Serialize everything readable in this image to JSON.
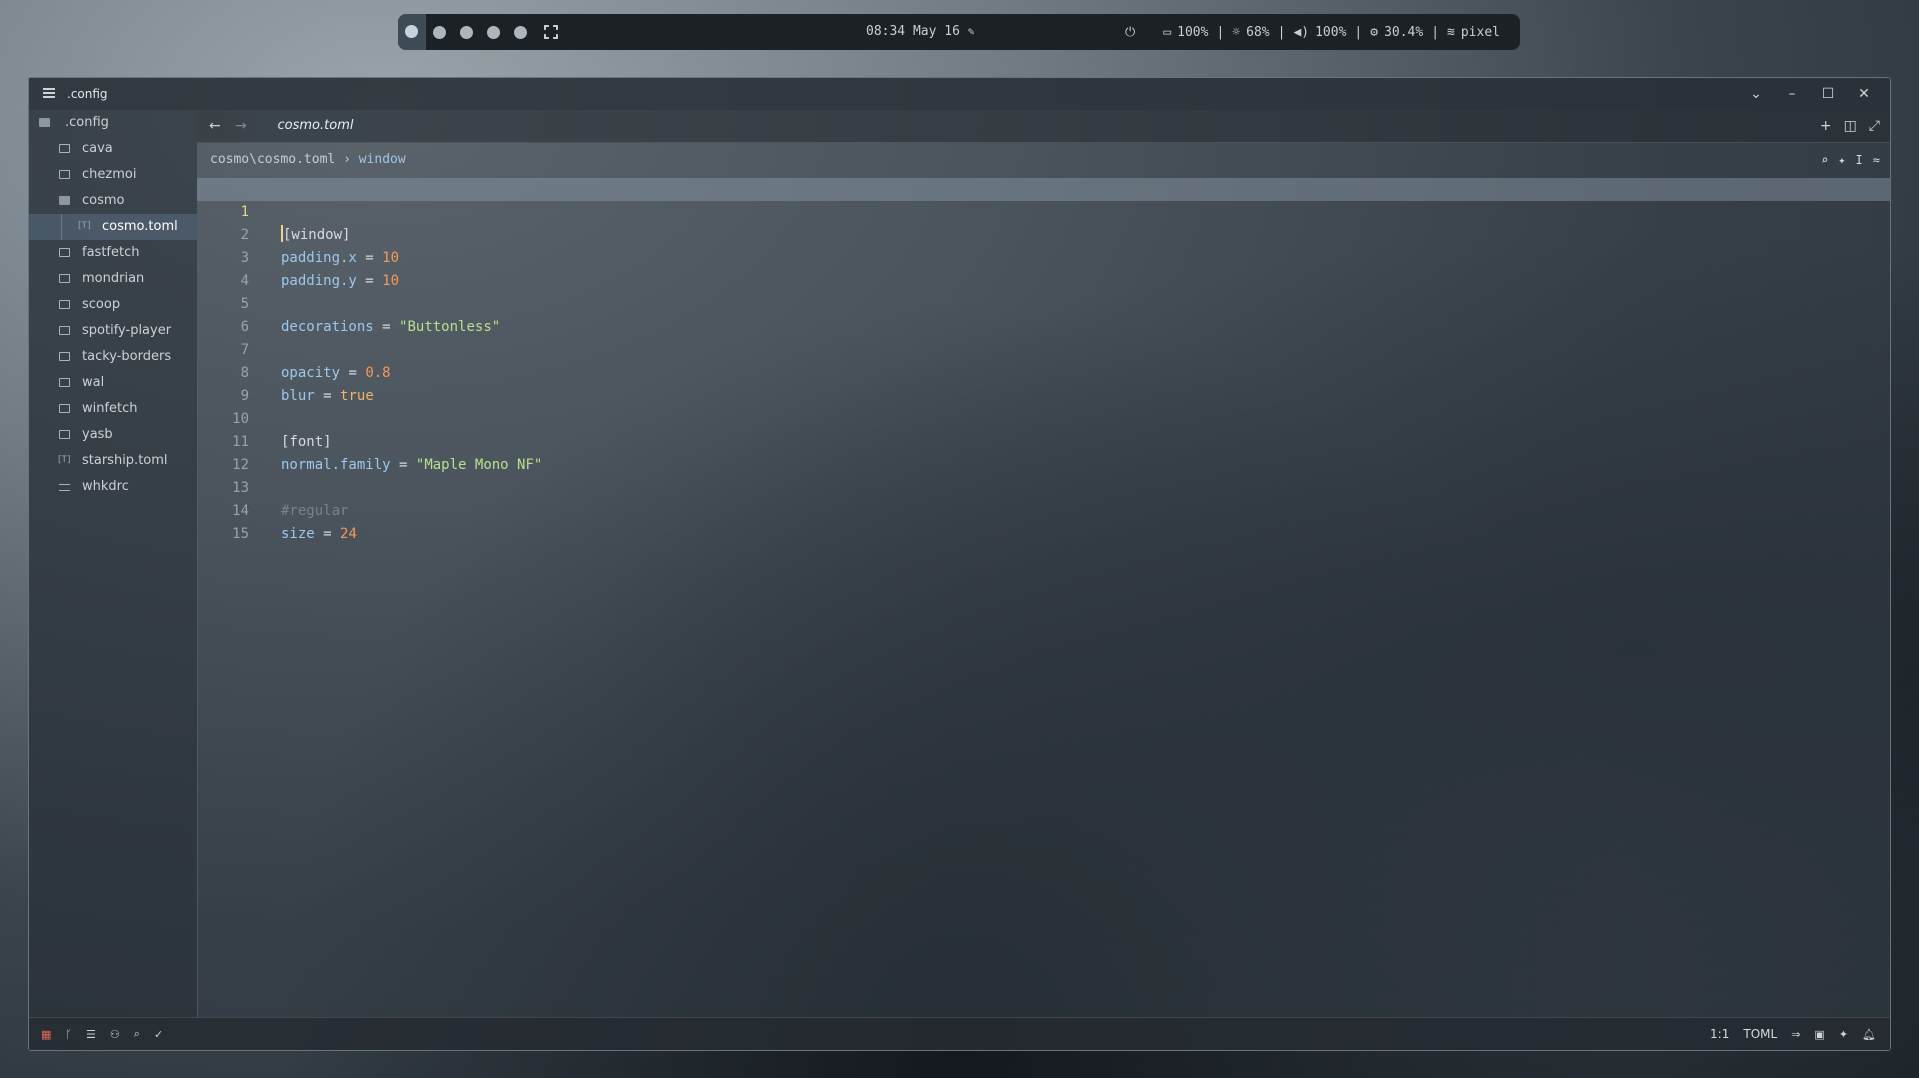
{
  "topbar": {
    "clock": "08:34 May 16",
    "battery": "100%",
    "brightness": "68%",
    "volume": "100%",
    "cpu": "30.4%",
    "network": "pixel"
  },
  "window": {
    "title": ".config"
  },
  "sidebar": {
    "root": ".config",
    "items": [
      {
        "label": "cava",
        "icon": "folder-icon"
      },
      {
        "label": "chezmoi",
        "icon": "folder-icon"
      },
      {
        "label": "cosmo",
        "icon": "folder-open-icon"
      },
      {
        "label": "cosmo.toml",
        "icon": "toml-file-icon"
      },
      {
        "label": "fastfetch",
        "icon": "folder-icon"
      },
      {
        "label": "mondrian",
        "icon": "folder-icon"
      },
      {
        "label": "scoop",
        "icon": "folder-icon"
      },
      {
        "label": "spotify-player",
        "icon": "folder-icon"
      },
      {
        "label": "tacky-borders",
        "icon": "folder-icon"
      },
      {
        "label": "wal",
        "icon": "folder-icon"
      },
      {
        "label": "winfetch",
        "icon": "folder-icon"
      },
      {
        "label": "yasb",
        "icon": "folder-icon"
      },
      {
        "label": "starship.toml",
        "icon": "toml-file-icon"
      },
      {
        "label": "whkdrc",
        "icon": "text-file-icon"
      }
    ]
  },
  "tabs": [
    {
      "label": "cosmo.toml",
      "active": true
    }
  ],
  "breadcrumb": {
    "path": "cosmo\\cosmo.toml",
    "separator": "›",
    "symbol": "window"
  },
  "code": {
    "language": "TOML",
    "lines": [
      {
        "n": "1",
        "text": "[window]"
      },
      {
        "n": "2",
        "text": "padding.x = 10"
      },
      {
        "n": "3",
        "text": "padding.y = 10"
      },
      {
        "n": "4",
        "text": ""
      },
      {
        "n": "5",
        "text": "decorations = \"Buttonless\""
      },
      {
        "n": "6",
        "text": ""
      },
      {
        "n": "7",
        "text": "opacity = 0.8"
      },
      {
        "n": "8",
        "text": "blur = true"
      },
      {
        "n": "9",
        "text": ""
      },
      {
        "n": "10",
        "text": "[font]"
      },
      {
        "n": "11",
        "text": "normal.family = \"Maple Mono NF\""
      },
      {
        "n": "12",
        "text": ""
      },
      {
        "n": "13",
        "text": "#regular"
      },
      {
        "n": "14",
        "text": "size = 24"
      },
      {
        "n": "15",
        "text": ""
      }
    ]
  },
  "statusbar": {
    "cursor_pos": "1:1",
    "language": "TOML"
  },
  "colors": {
    "accent": "#9dc8ec",
    "number": "#f29a5c",
    "string": "#b8e08e",
    "current_line_number": "#e8d58a"
  }
}
